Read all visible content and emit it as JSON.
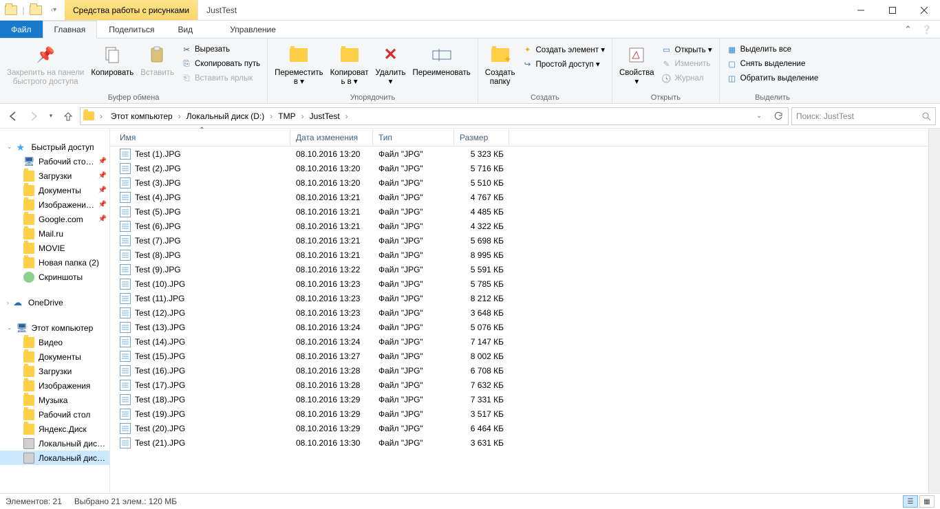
{
  "title": {
    "context_tab": "Средства работы с рисунками",
    "folder_name": "JustTest"
  },
  "ribbon_tabs": {
    "file": "Файл",
    "home": "Главная",
    "share": "Поделиться",
    "view": "Вид",
    "context": "Управление"
  },
  "ribbon": {
    "clipboard": {
      "pin": "Закрепить на панели\nбыстрого доступа",
      "copy": "Копировать",
      "paste": "Вставить",
      "cut": "Вырезать",
      "copy_path": "Скопировать путь",
      "paste_shortcut": "Вставить ярлык",
      "group": "Буфер обмена"
    },
    "organize": {
      "move_to": "Переместить\nв ▾",
      "copy_to": "Копироват\nь в ▾",
      "delete": "Удалить\n▾",
      "rename": "Переименовать",
      "group": "Упорядочить"
    },
    "new_group": {
      "new_folder": "Создать\nпапку",
      "new_item": "Создать элемент ▾",
      "easy_access": "Простой доступ ▾",
      "group": "Создать"
    },
    "open_group": {
      "properties": "Свойства\n▾",
      "open": "Открыть ▾",
      "edit": "Изменить",
      "history": "Журнал",
      "group": "Открыть"
    },
    "select_group": {
      "select_all": "Выделить все",
      "select_none": "Снять выделение",
      "invert": "Обратить выделение",
      "group": "Выделить"
    }
  },
  "breadcrumb": {
    "items": [
      "Этот компьютер",
      "Локальный диск (D:)",
      "TMP",
      "JustTest"
    ]
  },
  "search": {
    "placeholder": "Поиск: JustTest"
  },
  "nav": {
    "quick_access": "Быстрый доступ",
    "items_qa": [
      "Рабочий сто…",
      "Загрузки",
      "Документы",
      "Изображени…",
      "Google.com",
      "Mail.ru",
      "MOVIE",
      "Новая папка (2)",
      "Скриншоты"
    ],
    "onedrive": "OneDrive",
    "this_pc": "Этот компьютер",
    "items_pc": [
      "Видео",
      "Документы",
      "Загрузки",
      "Изображения",
      "Музыка",
      "Рабочий стол",
      "Яндекс.Диск",
      "Локальный дис…",
      "Локальный дис…"
    ]
  },
  "columns": {
    "name": "Имя",
    "date": "Дата изменения",
    "type": "Тип",
    "size": "Размер"
  },
  "files": [
    {
      "name": "Test (1).JPG",
      "date": "08.10.2016 13:20",
      "type": "Файл \"JPG\"",
      "size": "5 323 КБ"
    },
    {
      "name": "Test (2).JPG",
      "date": "08.10.2016 13:20",
      "type": "Файл \"JPG\"",
      "size": "5 716 КБ"
    },
    {
      "name": "Test (3).JPG",
      "date": "08.10.2016 13:20",
      "type": "Файл \"JPG\"",
      "size": "5 510 КБ"
    },
    {
      "name": "Test (4).JPG",
      "date": "08.10.2016 13:21",
      "type": "Файл \"JPG\"",
      "size": "4 767 КБ"
    },
    {
      "name": "Test (5).JPG",
      "date": "08.10.2016 13:21",
      "type": "Файл \"JPG\"",
      "size": "4 485 КБ"
    },
    {
      "name": "Test (6).JPG",
      "date": "08.10.2016 13:21",
      "type": "Файл \"JPG\"",
      "size": "4 322 КБ"
    },
    {
      "name": "Test (7).JPG",
      "date": "08.10.2016 13:21",
      "type": "Файл \"JPG\"",
      "size": "5 698 КБ"
    },
    {
      "name": "Test (8).JPG",
      "date": "08.10.2016 13:21",
      "type": "Файл \"JPG\"",
      "size": "8 995 КБ"
    },
    {
      "name": "Test (9).JPG",
      "date": "08.10.2016 13:22",
      "type": "Файл \"JPG\"",
      "size": "5 591 КБ"
    },
    {
      "name": "Test (10).JPG",
      "date": "08.10.2016 13:23",
      "type": "Файл \"JPG\"",
      "size": "5 785 КБ"
    },
    {
      "name": "Test (11).JPG",
      "date": "08.10.2016 13:23",
      "type": "Файл \"JPG\"",
      "size": "8 212 КБ"
    },
    {
      "name": "Test (12).JPG",
      "date": "08.10.2016 13:23",
      "type": "Файл \"JPG\"",
      "size": "3 648 КБ"
    },
    {
      "name": "Test (13).JPG",
      "date": "08.10.2016 13:24",
      "type": "Файл \"JPG\"",
      "size": "5 076 КБ"
    },
    {
      "name": "Test (14).JPG",
      "date": "08.10.2016 13:24",
      "type": "Файл \"JPG\"",
      "size": "7 147 КБ"
    },
    {
      "name": "Test (15).JPG",
      "date": "08.10.2016 13:27",
      "type": "Файл \"JPG\"",
      "size": "8 002 КБ"
    },
    {
      "name": "Test (16).JPG",
      "date": "08.10.2016 13:28",
      "type": "Файл \"JPG\"",
      "size": "6 708 КБ"
    },
    {
      "name": "Test (17).JPG",
      "date": "08.10.2016 13:28",
      "type": "Файл \"JPG\"",
      "size": "7 632 КБ"
    },
    {
      "name": "Test (18).JPG",
      "date": "08.10.2016 13:29",
      "type": "Файл \"JPG\"",
      "size": "7 331 КБ"
    },
    {
      "name": "Test (19).JPG",
      "date": "08.10.2016 13:29",
      "type": "Файл \"JPG\"",
      "size": "3 517 КБ"
    },
    {
      "name": "Test (20).JPG",
      "date": "08.10.2016 13:29",
      "type": "Файл \"JPG\"",
      "size": "6 464 КБ"
    },
    {
      "name": "Test (21).JPG",
      "date": "08.10.2016 13:30",
      "type": "Файл \"JPG\"",
      "size": "3 631 КБ"
    }
  ],
  "status": {
    "count": "Элементов: 21",
    "selection": "Выбрано 21 элем.: 120 МБ"
  }
}
